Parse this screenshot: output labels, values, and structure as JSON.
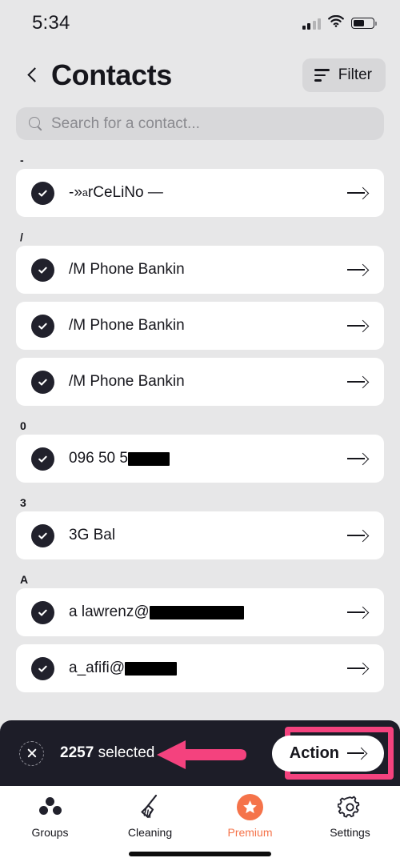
{
  "status_bar": {
    "time": "5:34",
    "signal_icon": "cellular-signal-icon",
    "wifi_icon": "wifi-icon",
    "battery_icon": "battery-icon",
    "battery_level_pct": 55
  },
  "header": {
    "back_icon": "chevron-left-icon",
    "title": "Contacts",
    "filter_label": "Filter",
    "filter_icon": "filter-lines-icon"
  },
  "search": {
    "placeholder": "Search for a contact...",
    "value": "",
    "icon": "search-icon"
  },
  "list": {
    "sections": [
      {
        "letter": "-",
        "rows": [
          {
            "name_pre": "-»",
            "sup": "a",
            "name_post": "rCeLiNo —",
            "redacted": false,
            "checked": true
          }
        ]
      },
      {
        "letter": "/",
        "rows": [
          {
            "name_pre": "/M Phone Bankin",
            "sup": "",
            "name_post": "",
            "redacted": false,
            "checked": true
          },
          {
            "name_pre": "/M Phone Bankin",
            "sup": "",
            "name_post": "",
            "redacted": false,
            "checked": true
          },
          {
            "name_pre": "/M Phone Bankin",
            "sup": "",
            "name_post": "",
            "redacted": false,
            "checked": true
          }
        ]
      },
      {
        "letter": "0",
        "rows": [
          {
            "name_pre": "096 50 5",
            "sup": "",
            "name_post": "",
            "redacted": true,
            "redact_width": 52,
            "checked": true
          }
        ]
      },
      {
        "letter": "3",
        "rows": [
          {
            "name_pre": "3G Bal",
            "sup": "",
            "name_post": "",
            "redacted": false,
            "checked": true
          }
        ]
      },
      {
        "letter": "A",
        "rows": [
          {
            "name_pre": "a lawrenz@",
            "sup": "",
            "name_post": "",
            "redacted": true,
            "redact_width": 118,
            "checked": true
          },
          {
            "name_pre": "a_afifi@",
            "sup": "",
            "name_post": "",
            "redacted": true,
            "redact_width": 65,
            "checked": true
          }
        ]
      }
    ]
  },
  "action_bar": {
    "close_icon": "close-circle-icon",
    "selected_count": "2257",
    "selected_label": "selected",
    "action_label": "Action",
    "action_arrow_icon": "arrow-right-icon",
    "highlight_color": "#f4427e",
    "annotation_arrow_icon": "annotation-arrow-left"
  },
  "tabbar": {
    "tabs": [
      {
        "label": "Groups",
        "icon": "groups-dots-icon",
        "active": false
      },
      {
        "label": "Cleaning",
        "icon": "broom-icon",
        "active": false
      },
      {
        "label": "Premium",
        "icon": "star-badge-icon",
        "active": true
      },
      {
        "label": "Settings",
        "icon": "gear-icon",
        "active": false
      }
    ],
    "premium_color": "#f5734a"
  }
}
